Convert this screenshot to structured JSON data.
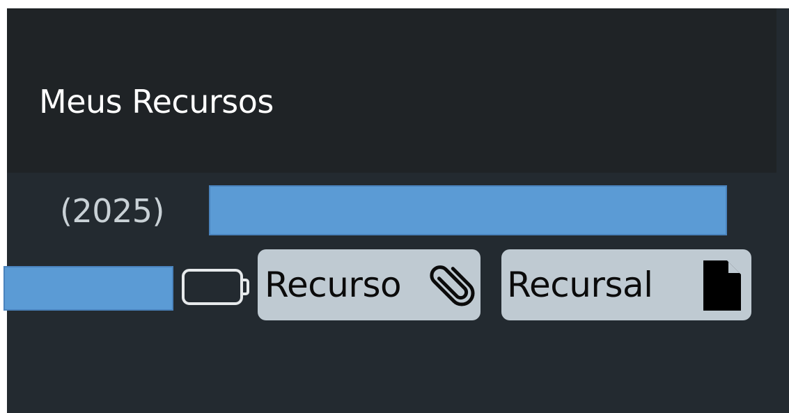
{
  "header": {
    "title": "Meus Recursos"
  },
  "item": {
    "year": "(2025)",
    "tags": [
      {
        "label": "Recurso",
        "icon": "paperclip-icon"
      },
      {
        "label": "Recursal",
        "icon": "document-icon"
      }
    ],
    "status_icon": "battery-empty-icon"
  },
  "colors": {
    "page_bg": "#232a30",
    "header_bg": "#1f2326",
    "redaction": "#5b9bd5",
    "tag_bg": "#bfcad2",
    "header_text": "#ffffff",
    "muted_text": "#c9d1d6"
  }
}
